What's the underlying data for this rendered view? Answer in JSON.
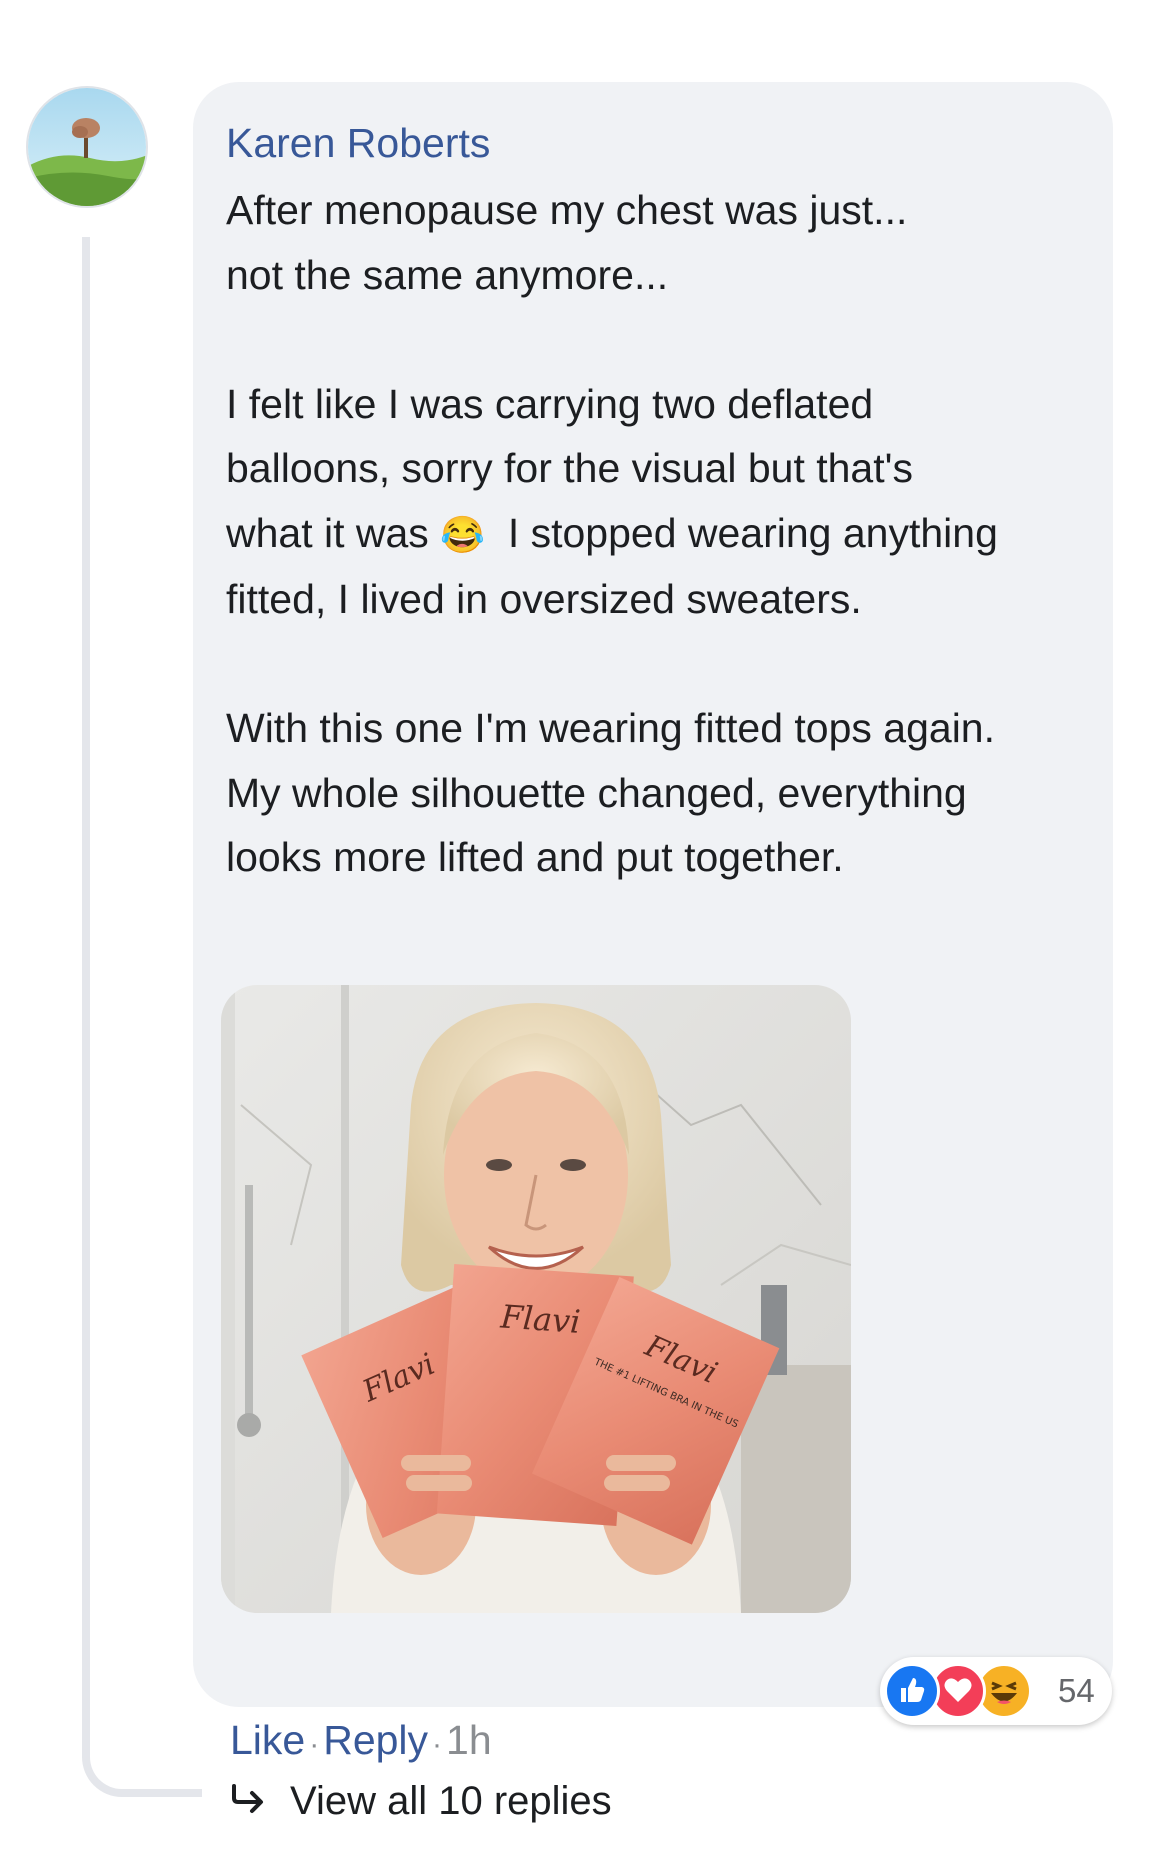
{
  "comment": {
    "author": "Karen Roberts",
    "paragraphs": [
      {
        "lines": [
          "After menopause my chest was just...",
          "not the same anymore..."
        ]
      },
      {
        "lines": [
          "I felt like I was carrying two deflated",
          "balloons, sorry for the visual but that's"
        ],
        "emoji_line_before": "what it was ",
        "emoji": "😂",
        "emoji_line_after": "  I stopped wearing anything",
        "last_line": "fitted, I lived in oversized sweaters."
      },
      {
        "lines": [
          "With this one I'm wearing fitted tops again.",
          "My whole silhouette changed, everything",
          "looks more lifted and put together."
        ]
      }
    ],
    "image": {
      "package_brand": "Flavi",
      "package_tagline": "THE #1 LIFTING BRA IN THE US"
    }
  },
  "reactions": {
    "icons": [
      "like-icon",
      "love-icon",
      "haha-icon"
    ],
    "count": "54"
  },
  "actions": {
    "like_label": "Like",
    "separator": "·",
    "reply_label": "Reply",
    "time": "1h"
  },
  "replies": {
    "label": "View all 10 replies"
  },
  "colors": {
    "link_blue": "#385898",
    "bubble_gray": "#f0f2f5",
    "like_blue": "#1877f2",
    "love_red": "#f33e58",
    "haha_yellow": "#f7b125"
  }
}
